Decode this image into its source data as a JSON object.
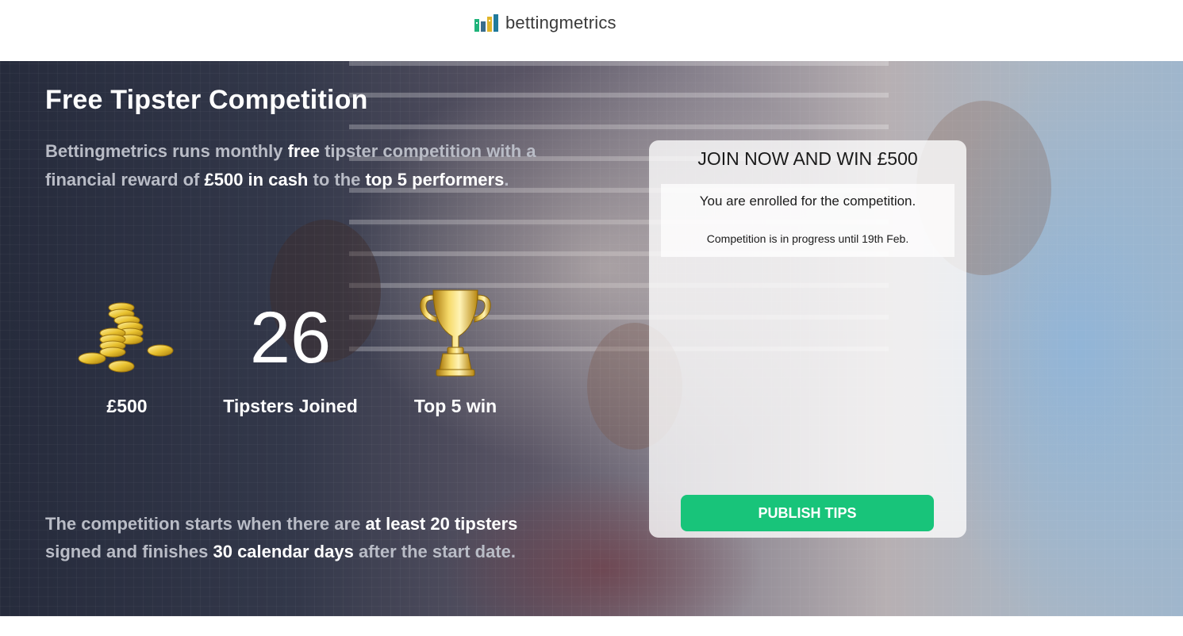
{
  "header": {
    "brand": "bettingmetrics",
    "logo_colors": [
      "#1fb37a",
      "#3a6d8c",
      "#e0b52a",
      "#1f7a9c"
    ]
  },
  "hero": {
    "title": "Free Tipster Competition",
    "description": {
      "p1": "Bettingmetrics runs monthly ",
      "p1_hl": "free",
      "p2": " tipster competition with a financial reward of ",
      "p2_hl": "£500 in cash",
      "p3": " to the ",
      "p3_hl": "top 5 performers",
      "p4": "."
    },
    "stats": [
      {
        "icon": "coins-icon",
        "value": "",
        "label": "£500"
      },
      {
        "icon": "",
        "value": "26",
        "label": "Tipsters Joined"
      },
      {
        "icon": "trophy-icon",
        "value": "",
        "label": "Top 5 win"
      }
    ],
    "footer": {
      "p1": "The competition starts when there are ",
      "p1_hl": "at least 20 tipsters",
      "p2": " signed and finishes ",
      "p2_hl": "30 calendar days",
      "p3": " after the start date."
    }
  },
  "card": {
    "title": "JOIN NOW AND WIN £500",
    "status_main": "You are enrolled for the competition.",
    "status_sub": "Competition is in progress until 19th Feb.",
    "button_label": "PUBLISH TIPS",
    "button_color": "#18c47a"
  }
}
